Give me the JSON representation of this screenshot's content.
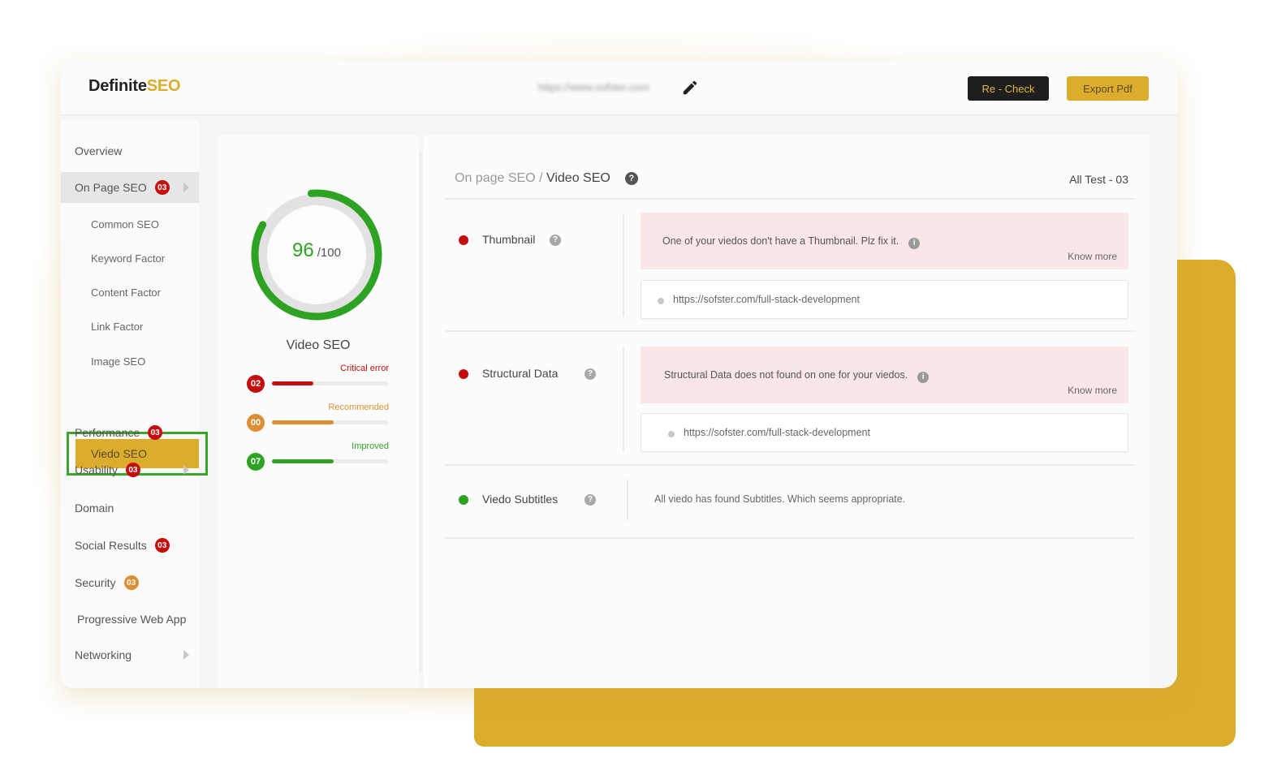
{
  "app": {
    "logo_main": "Definite",
    "logo_accent": "SEO",
    "url_blurred": "https://www.sofster.com",
    "edit_icon": "pencil-icon",
    "buttons": {
      "recheck": "Re - Check",
      "export": "Export Pdf"
    },
    "colors": {
      "accent": "#dcad2c",
      "dark": "#1e1e1e",
      "critical": "#c60d0d",
      "recommended": "#df8f33",
      "improved": "#2ea222"
    }
  },
  "sidebar": {
    "items": [
      {
        "label": "Overview"
      },
      {
        "label": "On Page SEO",
        "badge": "03",
        "badge_color": "red",
        "expandable": true,
        "expanded": true
      },
      {
        "label": "Common SEO",
        "sub": true
      },
      {
        "label": "Keyword Factor",
        "sub": true
      },
      {
        "label": "Content Factor",
        "sub": true
      },
      {
        "label": "Link Factor",
        "sub": true
      },
      {
        "label": "Image SEO",
        "sub": true
      },
      {
        "label": "Viedo SEO",
        "sub": true,
        "active": true
      },
      {
        "label": "Performance",
        "badge": "03",
        "badge_color": "red"
      },
      {
        "label": "Usability",
        "badge": "03",
        "badge_color": "red",
        "expandable": true
      },
      {
        "label": "Domain"
      },
      {
        "label": "Social Results",
        "badge": "03",
        "badge_color": "red"
      },
      {
        "label": "Security",
        "badge": "03",
        "badge_color": "orange"
      },
      {
        "label": "Progressive Web App"
      },
      {
        "label": "Networking",
        "expandable": true
      }
    ]
  },
  "score": {
    "value": "96",
    "max": "/100",
    "percent": 96,
    "label": "Video SEO",
    "stats": [
      {
        "count": "02",
        "label": "Critical error",
        "color": "#c60d0d",
        "fill_fraction": 0.36
      },
      {
        "count": "00",
        "label": "Recommended",
        "color": "#df8f33",
        "fill_fraction": 0.53
      },
      {
        "count": "07",
        "label": "Improved",
        "color": "#2ea222",
        "fill_fraction": 0.53
      }
    ]
  },
  "results": {
    "breadcrumb_parent": "On page SEO",
    "breadcrumb_sep": " / ",
    "breadcrumb_current": "Video SEO",
    "help_glyph": "?",
    "all_test": "All Test - 03",
    "tests": [
      {
        "name": "Thumbnail",
        "status": "error",
        "status_color": "#c60d0d",
        "message": "One of your viedos don't have a Thumbnail. Plz fix it.",
        "know_more": "Know more",
        "url": "https://sofster.com/full-stack-development"
      },
      {
        "name": "Structural Data",
        "status": "error",
        "status_color": "#c60d0d",
        "message": "Structural Data does not found on one for your viedos.",
        "know_more": "Know more",
        "url": "https://sofster.com/full-stack-development"
      },
      {
        "name": "Viedo Subtitles",
        "status": "pass",
        "status_color": "#2ea222",
        "message": "All viedo has found Subtitles. Which seems appropriate."
      }
    ]
  }
}
